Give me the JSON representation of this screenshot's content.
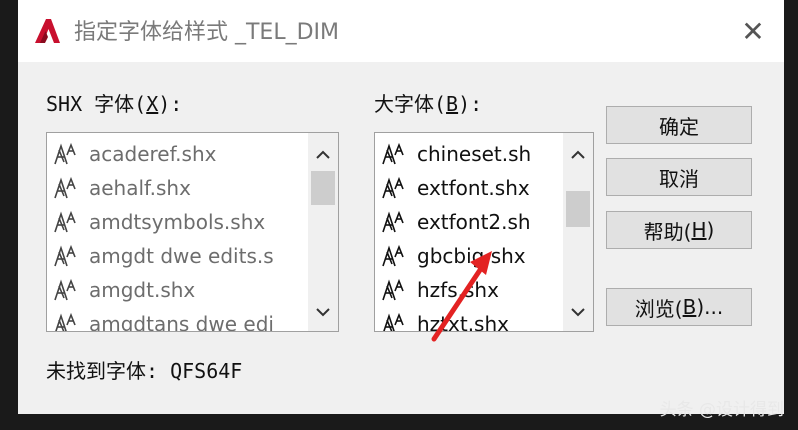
{
  "window": {
    "title": "指定字体给样式 _TEL_DIM",
    "close_symbol": "✕"
  },
  "shx_panel": {
    "label": "SHX 字体(",
    "label_key": "X",
    "label_end": "):",
    "items": [
      "acaderef.shx",
      "aehalf.shx",
      "amdtsymbols.shx",
      "amgdt dwe edits.s",
      "amgdt.shx",
      "amgdtans dwe edi"
    ]
  },
  "bigfont_panel": {
    "label": "大字体(",
    "label_key": "B",
    "label_end": "):",
    "items": [
      "chineset.sh",
      "extfont.shx",
      "extfont2.sh",
      "gbcbig.shx",
      "hzfs.shx",
      "hztxt.shx"
    ]
  },
  "buttons": {
    "ok": "确定",
    "cancel": "取消",
    "help_prefix": "帮助(",
    "help_key": "H",
    "help_suffix": ")",
    "browse_prefix": "浏览(",
    "browse_key": "B",
    "browse_suffix": ")..."
  },
  "status": {
    "label": "未找到字体:",
    "value": "QFS64F"
  },
  "watermark": "头条 @设计得到",
  "colors": {
    "accent_arrow": "#e32222",
    "autocad_icon": "#c8102e"
  },
  "icons": {
    "app": "autocad-logo-icon",
    "font_item": "shx-font-icon"
  }
}
